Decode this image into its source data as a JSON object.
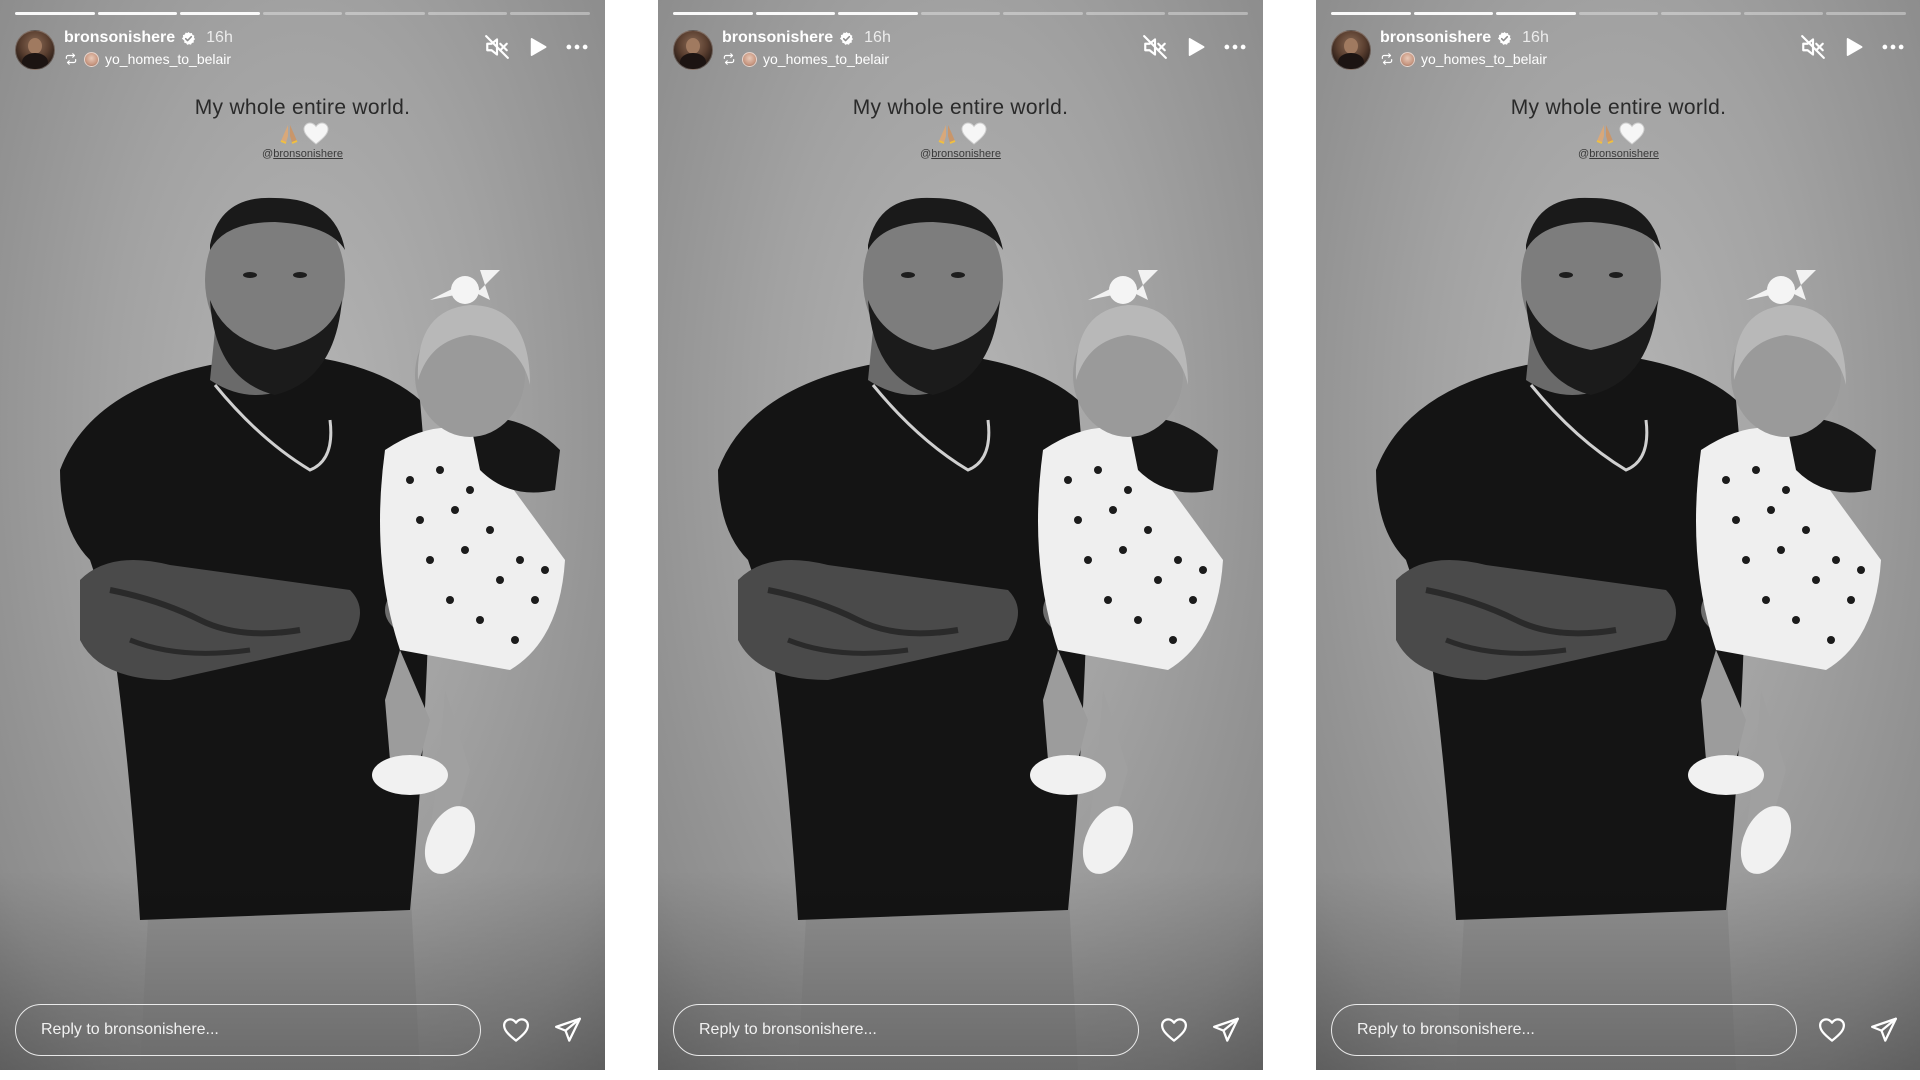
{
  "story": {
    "username": "bronsonishere",
    "time_ago": "16h",
    "reposted_from": "yo_homes_to_belair",
    "caption": "My whole entire world.",
    "emojis": [
      "folded-hands-emoji",
      "white-heart-emoji"
    ],
    "mention_prefix": "@",
    "mention": "bronsonishere",
    "reply_placeholder": "Reply to bronsonishere...",
    "progress": {
      "segments": 7,
      "completed": 3
    },
    "icons": {
      "mute": "speaker-muted-icon",
      "play": "play-icon",
      "more": "more-horizontal-icon",
      "verified": "verified-badge-icon",
      "repost": "repost-icon",
      "like": "heart-icon",
      "share": "send-icon"
    },
    "colors": {
      "text": "#ffffff",
      "caption": "#2a2a2a",
      "verified_badge": "#ffffff"
    }
  },
  "panels": [
    "story-panel-1",
    "story-panel-2",
    "story-panel-3"
  ]
}
